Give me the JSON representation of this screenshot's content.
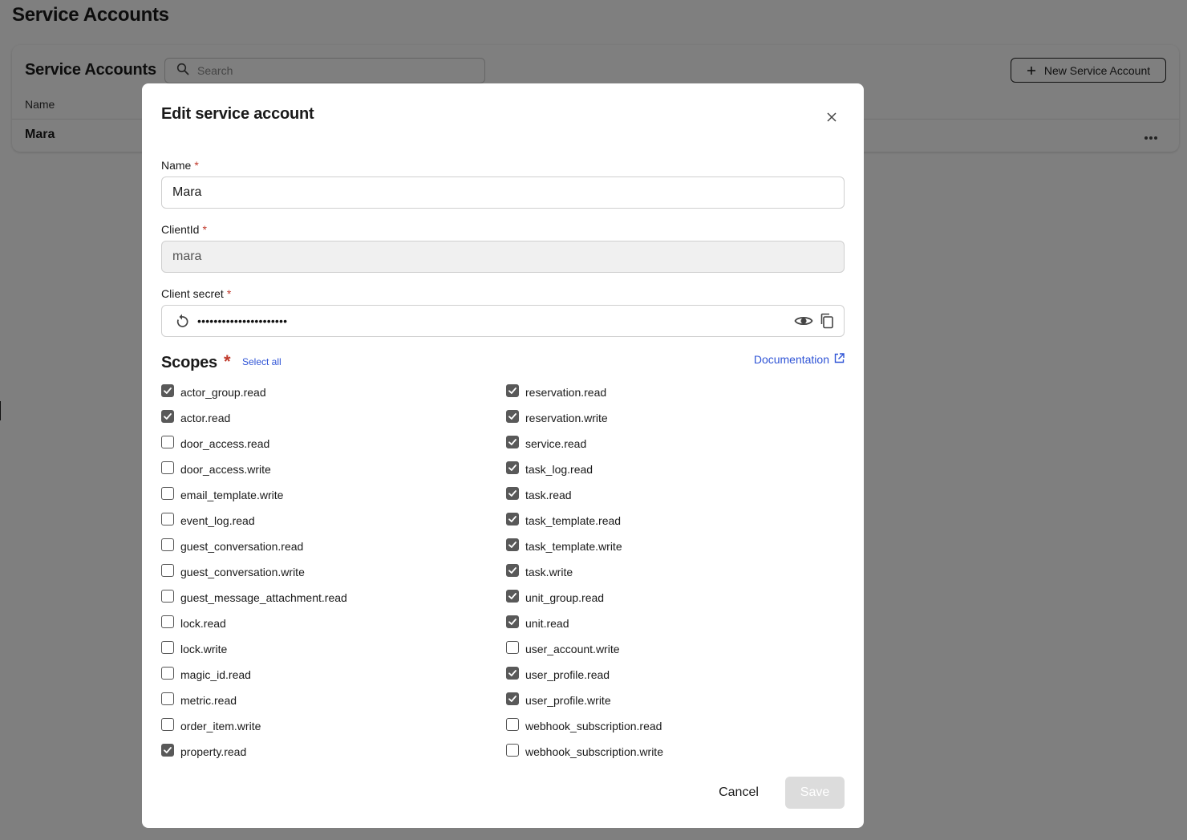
{
  "page": {
    "title": "Service Accounts",
    "card_title": "Service Accounts",
    "search_placeholder": "Search",
    "new_button_label": "New Service Account",
    "column_name": "Name",
    "rows": [
      {
        "name": "Mara"
      }
    ]
  },
  "modal": {
    "title": "Edit service account",
    "name": {
      "label": "Name",
      "required_mark": "*",
      "value": "Mara"
    },
    "client_id": {
      "label": "ClientId",
      "required_mark": "*",
      "value": "mara"
    },
    "client_secret": {
      "label": "Client secret",
      "required_mark": "*",
      "value": "••••••••••••••••••••••"
    },
    "scopes": {
      "title": "Scopes",
      "required_mark": "*",
      "select_all": "Select all",
      "documentation": "Documentation",
      "left": [
        {
          "label": "actor_group.read",
          "checked": true
        },
        {
          "label": "actor.read",
          "checked": true
        },
        {
          "label": "door_access.read",
          "checked": false
        },
        {
          "label": "door_access.write",
          "checked": false
        },
        {
          "label": "email_template.write",
          "checked": false
        },
        {
          "label": "event_log.read",
          "checked": false
        },
        {
          "label": "guest_conversation.read",
          "checked": false
        },
        {
          "label": "guest_conversation.write",
          "checked": false
        },
        {
          "label": "guest_message_attachment.read",
          "checked": false
        },
        {
          "label": "lock.read",
          "checked": false
        },
        {
          "label": "lock.write",
          "checked": false
        },
        {
          "label": "magic_id.read",
          "checked": false
        },
        {
          "label": "metric.read",
          "checked": false
        },
        {
          "label": "order_item.write",
          "checked": false
        },
        {
          "label": "property.read",
          "checked": true
        }
      ],
      "right": [
        {
          "label": "reservation.read",
          "checked": true
        },
        {
          "label": "reservation.write",
          "checked": true
        },
        {
          "label": "service.read",
          "checked": true
        },
        {
          "label": "task_log.read",
          "checked": true
        },
        {
          "label": "task.read",
          "checked": true
        },
        {
          "label": "task_template.read",
          "checked": true
        },
        {
          "label": "task_template.write",
          "checked": true
        },
        {
          "label": "task.write",
          "checked": true
        },
        {
          "label": "unit_group.read",
          "checked": true
        },
        {
          "label": "unit.read",
          "checked": true
        },
        {
          "label": "user_account.write",
          "checked": false
        },
        {
          "label": "user_profile.read",
          "checked": true
        },
        {
          "label": "user_profile.write",
          "checked": true
        },
        {
          "label": "webhook_subscription.read",
          "checked": false
        },
        {
          "label": "webhook_subscription.write",
          "checked": false
        }
      ]
    },
    "cancel_label": "Cancel",
    "save_label": "Save"
  },
  "colors": {
    "overlay": "#808080",
    "link": "#2f54d6",
    "required": "#c0392b",
    "checkbox_checked": "#595959",
    "save_disabled": "#dcdcdc"
  },
  "icons": [
    "search-icon",
    "plus-icon",
    "more-icon",
    "close-icon",
    "regenerate-icon",
    "eye-icon",
    "copy-icon",
    "external-link-icon",
    "check-icon"
  ]
}
